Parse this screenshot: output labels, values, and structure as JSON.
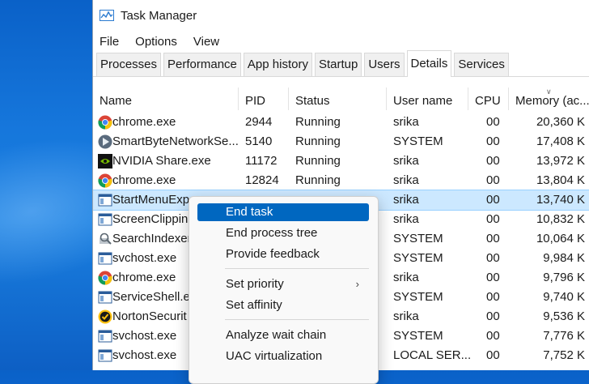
{
  "window": {
    "title": "Task Manager"
  },
  "menubar": {
    "items": [
      "File",
      "Options",
      "View"
    ]
  },
  "tabs": [
    {
      "label": "Processes"
    },
    {
      "label": "Performance"
    },
    {
      "label": "App history"
    },
    {
      "label": "Startup"
    },
    {
      "label": "Users"
    },
    {
      "label": "Details",
      "active": true
    },
    {
      "label": "Services"
    }
  ],
  "columns": {
    "name": "Name",
    "pid": "PID",
    "status": "Status",
    "user": "User name",
    "cpu": "CPU",
    "memory": "Memory (ac..."
  },
  "rows": [
    {
      "name": "chrome.exe",
      "pid": "2944",
      "status": "Running",
      "user": "srika",
      "cpu": "00",
      "memory": "20,360 K",
      "icon": "chrome-icon"
    },
    {
      "name": "SmartByteNetworkSe...",
      "pid": "5140",
      "status": "Running",
      "user": "SYSTEM",
      "cpu": "00",
      "memory": "17,408 K",
      "icon": "smartbyte-icon"
    },
    {
      "name": "NVIDIA Share.exe",
      "pid": "11172",
      "status": "Running",
      "user": "srika",
      "cpu": "00",
      "memory": "13,972 K",
      "icon": "nvidia-icon"
    },
    {
      "name": "chrome.exe",
      "pid": "12824",
      "status": "Running",
      "user": "srika",
      "cpu": "00",
      "memory": "13,804 K",
      "icon": "chrome-icon"
    },
    {
      "name": "StartMenuExp",
      "pid": "",
      "status": "",
      "user": "srika",
      "cpu": "00",
      "memory": "13,740 K",
      "icon": "window-icon",
      "selected": true
    },
    {
      "name": "ScreenClippin",
      "pid": "",
      "status": "",
      "user": "srika",
      "cpu": "00",
      "memory": "10,832 K",
      "icon": "window-icon"
    },
    {
      "name": "SearchIndexer",
      "pid": "",
      "status": "",
      "user": "SYSTEM",
      "cpu": "00",
      "memory": "10,064 K",
      "icon": "search-indexer-icon"
    },
    {
      "name": "svchost.exe",
      "pid": "",
      "status": "",
      "user": "SYSTEM",
      "cpu": "00",
      "memory": "9,984 K",
      "icon": "window-icon"
    },
    {
      "name": "chrome.exe",
      "pid": "",
      "status": "",
      "user": "srika",
      "cpu": "00",
      "memory": "9,796 K",
      "icon": "chrome-icon"
    },
    {
      "name": "ServiceShell.e",
      "pid": "",
      "status": "",
      "user": "SYSTEM",
      "cpu": "00",
      "memory": "9,740 K",
      "icon": "window-icon"
    },
    {
      "name": "NortonSecurit",
      "pid": "",
      "status": "",
      "user": "srika",
      "cpu": "00",
      "memory": "9,536 K",
      "icon": "norton-icon"
    },
    {
      "name": "svchost.exe",
      "pid": "",
      "status": "",
      "user": "SYSTEM",
      "cpu": "00",
      "memory": "7,776 K",
      "icon": "window-icon"
    },
    {
      "name": "svchost.exe",
      "pid": "",
      "status": "",
      "user": "LOCAL SER...",
      "cpu": "00",
      "memory": "7,752 K",
      "icon": "window-icon"
    }
  ],
  "context_menu": {
    "items": [
      {
        "label": "End task",
        "highlight": true
      },
      {
        "label": "End process tree"
      },
      {
        "label": "Provide feedback"
      },
      {
        "label": "Set priority",
        "submenu": true
      },
      {
        "label": "Set affinity"
      },
      {
        "label": "Analyze wait chain"
      },
      {
        "label": "UAC virtualization"
      }
    ]
  },
  "colors": {
    "selection": "#cce8ff",
    "menu_highlight": "#0067c0",
    "desktop": "#1677dc"
  }
}
